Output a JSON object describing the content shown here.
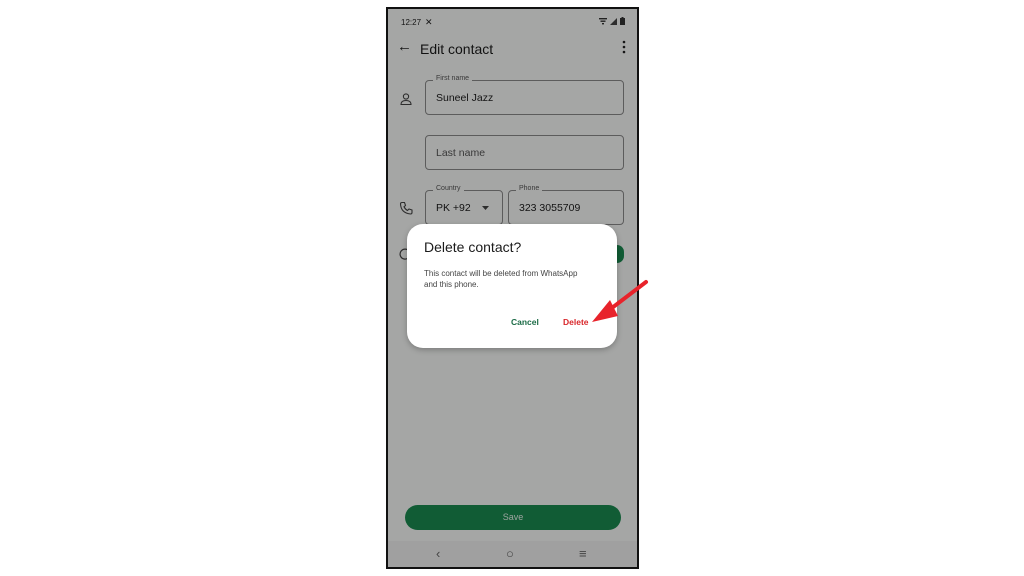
{
  "status_bar": {
    "time": "12:27",
    "nfc_icon": "✕"
  },
  "app_bar": {
    "title": "Edit contact",
    "back_icon": "←"
  },
  "form": {
    "first_name": {
      "label": "First name",
      "value": "Suneel Jazz"
    },
    "last_name": {
      "placeholder": "Last name"
    },
    "country": {
      "label": "Country",
      "value": "PK +92"
    },
    "phone": {
      "label": "Phone",
      "value": "323 3055709"
    }
  },
  "save_button": {
    "label": "Save"
  },
  "dialog": {
    "title": "Delete contact?",
    "body": "This contact will be deleted from WhatsApp and this phone.",
    "cancel_label": "Cancel",
    "delete_label": "Delete"
  },
  "nav_bar": {
    "back": "‹",
    "home": "○",
    "recents": "≡"
  },
  "colors": {
    "accent_green": "#1a8a4f",
    "delete_red": "#d8262a",
    "annotation_arrow": "#e8232b"
  }
}
